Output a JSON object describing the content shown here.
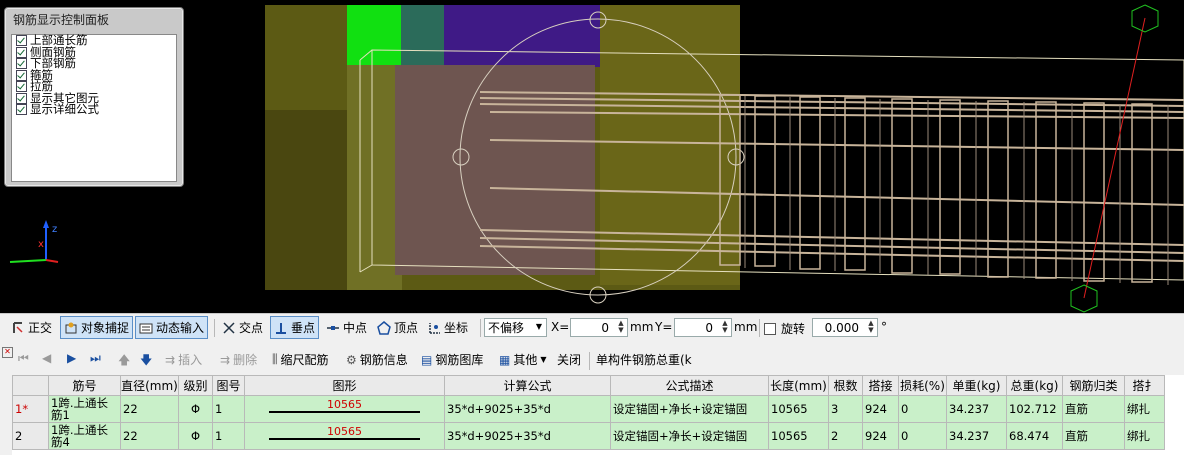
{
  "control_panel": {
    "title": "钢筋显示控制面板",
    "items": [
      {
        "label": "上部通长筋",
        "checked": true
      },
      {
        "label": "侧面钢筋",
        "checked": true
      },
      {
        "label": "下部钢筋",
        "checked": true
      },
      {
        "label": "箍筋",
        "checked": true
      },
      {
        "label": "拉筋",
        "checked": true
      },
      {
        "label": "显示其它图元",
        "checked": true
      },
      {
        "label": "显示详细公式",
        "checked": true
      }
    ]
  },
  "snap_toolbar": {
    "ortho": "正交",
    "object_snap": "对象捕捉",
    "dynamic_input": "动态输入",
    "intersection": "交点",
    "perpendicular": "垂点",
    "midpoint": "中点",
    "vertex": "顶点",
    "coordinate": "坐标",
    "offset_select": "不偏移",
    "x_label": "X=",
    "x_value": "0",
    "y_label": "Y=",
    "y_value": "0",
    "unit": "mm",
    "rotate_label": "旋转",
    "rotate_value": "0.000",
    "degree": "°"
  },
  "edit_toolbar": {
    "insert": "插入",
    "delete": "删除",
    "scale_rebar": "缩尺配筋",
    "rebar_info": "钢筋信息",
    "rebar_library": "钢筋图库",
    "other": "其他",
    "close": "关闭",
    "component_total": "单构件钢筋总重(k"
  },
  "table": {
    "headers": [
      "",
      "筋号",
      "直径(mm)",
      "级别",
      "图号",
      "图形",
      "计算公式",
      "公式描述",
      "长度(mm)",
      "根数",
      "搭接",
      "损耗(%)",
      "单重(kg)",
      "总重(kg)",
      "钢筋归类",
      "搭扌"
    ],
    "rows": [
      {
        "index": "1*",
        "name": "1跨.上通长筋1",
        "diameter": "22",
        "grade": "Φ",
        "figure": "1",
        "shape_value": "10565",
        "formula": "35*d+9025+35*d",
        "description": "设定锚固+净长+设定锚固",
        "length": "10565",
        "count": "3",
        "lap": "924",
        "loss": "0",
        "unit_weight": "34.237",
        "total_weight": "102.712",
        "category": "直筋",
        "lap_type": "绑扎"
      },
      {
        "index": "2",
        "name": "1跨.上通长筋4",
        "diameter": "22",
        "grade": "Φ",
        "figure": "1",
        "shape_value": "10565",
        "formula": "35*d+9025+35*d",
        "description": "设定锚固+净长+设定锚固",
        "length": "10565",
        "count": "2",
        "lap": "924",
        "loss": "0",
        "unit_weight": "34.237",
        "total_weight": "68.474",
        "category": "直筋",
        "lap_type": "绑扎"
      }
    ]
  },
  "colors": {
    "viewport_bg": "#000000",
    "column_olive": "#5e5a14",
    "green_box": "#11e011",
    "purple_box": "#3f1a86",
    "rebar": "#c8b49a",
    "row_green": "#c9f0c9",
    "shape_red": "#d00000"
  }
}
